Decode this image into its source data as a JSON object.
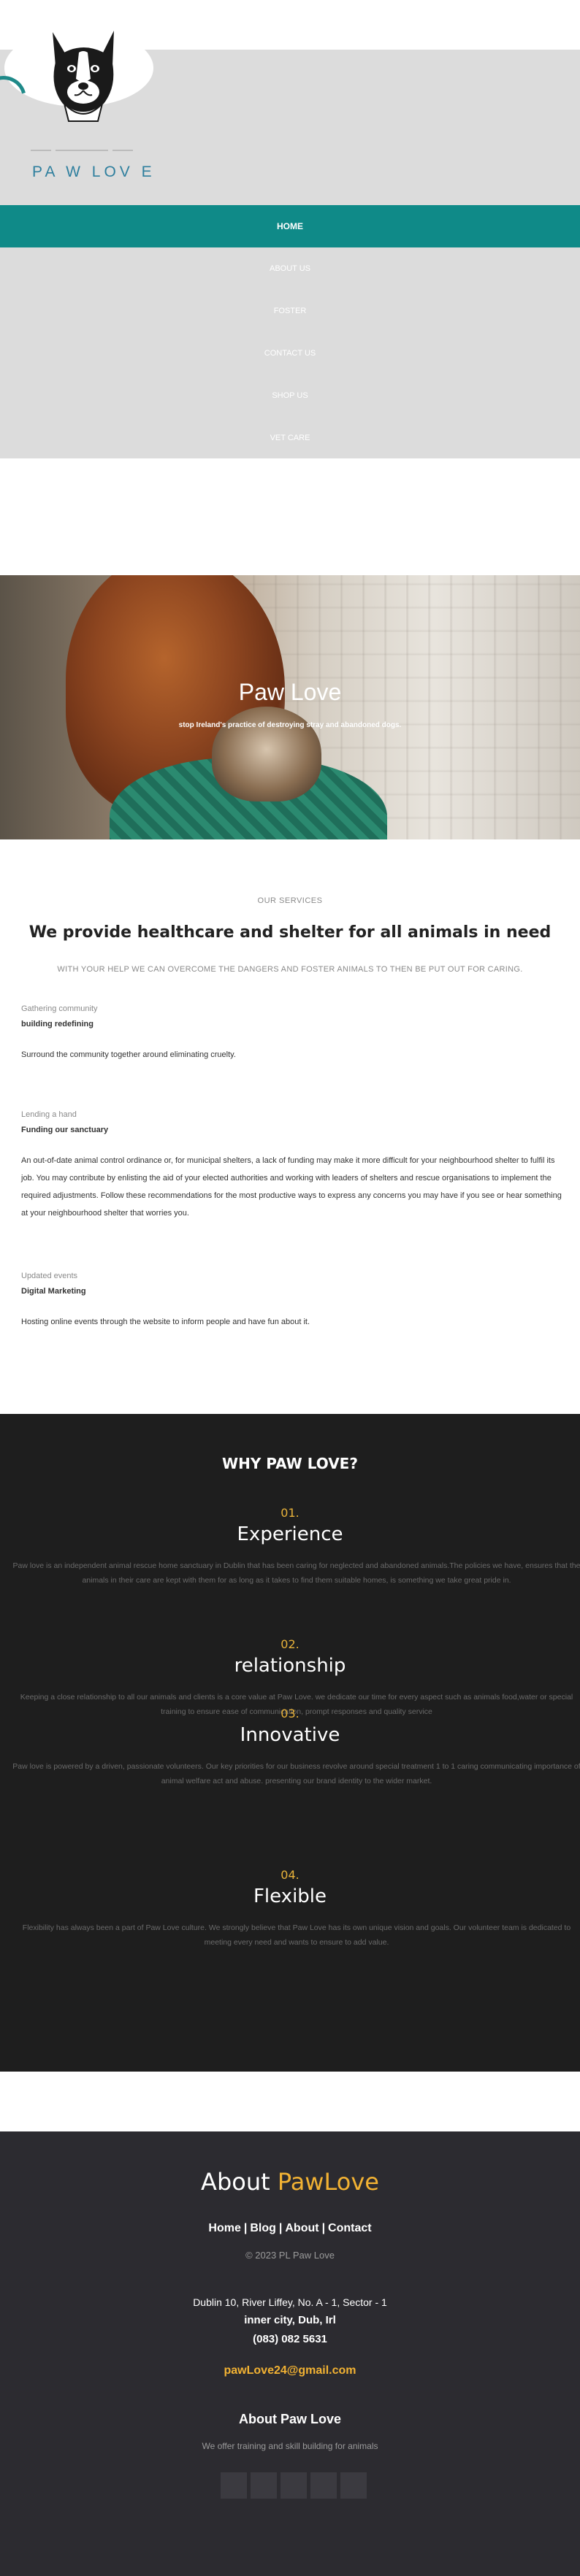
{
  "brand": {
    "name": "PA W LOV E",
    "accent_color": "#0f8a88"
  },
  "nav": {
    "items": [
      {
        "label": "HOME",
        "active": true
      },
      {
        "label": "ABOUT US",
        "active": false
      },
      {
        "label": "FOSTER",
        "active": false
      },
      {
        "label": "CONTACT US",
        "active": false
      },
      {
        "label": "SHOP US",
        "active": false
      },
      {
        "label": "VET CARE",
        "active": false
      }
    ]
  },
  "hero": {
    "title": "Paw Love",
    "subtitle": "stop Ireland's practice of destroying stray and abandoned dogs."
  },
  "services": {
    "eyebrow": "OUR SERVICES",
    "title": "We provide healthcare and shelter for all animals in need",
    "subtitle": "WITH YOUR HELP WE CAN OVERCOME THE DANGERS AND FOSTER ANIMALS TO THEN BE PUT OUT FOR CARING.",
    "items": [
      {
        "label": "Gathering community",
        "name": "building redefining",
        "text": "Surround the community together around eliminating cruelty."
      },
      {
        "label": "Lending a hand",
        "name": "Funding our sanctuary",
        "text": "An out-of-date animal control ordinance or, for municipal shelters, a lack of funding may make it more difficult for your neighbourhood shelter to fulfil its job. You may contribute by enlisting the aid of your elected authorities and working with leaders of shelters and rescue organisations to implement the required adjustments. Follow these recommendations for the most productive ways to express any concerns you may have if you see or hear something at your neighbourhood shelter that worries you."
      },
      {
        "label": "Updated events",
        "name": "Digital Marketing",
        "text": "Hosting online events through the website to inform people and have fun about it."
      }
    ]
  },
  "why": {
    "title": "WHY PAW LOVE?",
    "items": [
      {
        "number": "01.",
        "heading": "Experience",
        "text": "Paw love is an independent animal rescue home sanctuary in Dublin that has been caring for neglected and abandoned animals.The policies we have, ensures that the animals in their care are kept with them for as long as it takes to find them suitable homes, is something we take great pride in."
      },
      {
        "number": "02.",
        "heading": "relationship",
        "text": "Keeping a close relationship to all our animals and clients is a core value at Paw Love. we dedicate our time for every aspect such as animals food,water or special training to ensure ease of communication, prompt responses and quality service"
      },
      {
        "number": "03.",
        "heading": "Innovative",
        "text": "Paw love is powered by a driven, passionate volunteers. Our key priorities for our business revolve around special treatment 1 to 1 caring communicating importance of animal welfare act and abuse. presenting our brand identity to the wider market."
      },
      {
        "number": "04.",
        "heading": "Flexible",
        "text": "Flexibility has always been a part of Paw Love culture. We strongly believe that Paw Love has its own unique vision and goals. Our volunteer team is dedicated to meeting every need and wants to ensure to add value."
      }
    ]
  },
  "footer": {
    "about_prefix": "About",
    "about_accent": "PawLove",
    "links": [
      "Home",
      "Blog",
      "About",
      "Contact"
    ],
    "separator": "|",
    "copyright": "© 2023 PL Paw Love",
    "address_line1": "Dublin 10, River Liffey, No. A - 1, Sector - 1",
    "address_line2": "inner city, Dub, Irl",
    "phone": "(083) 082 5631",
    "email": "pawLove24@gmail.com",
    "about_title": "About Paw Love",
    "about_text": "We offer training and skill building for animals",
    "socials": [
      "social-icon-1",
      "social-icon-2",
      "social-icon-3",
      "social-icon-4",
      "social-icon-5"
    ]
  }
}
